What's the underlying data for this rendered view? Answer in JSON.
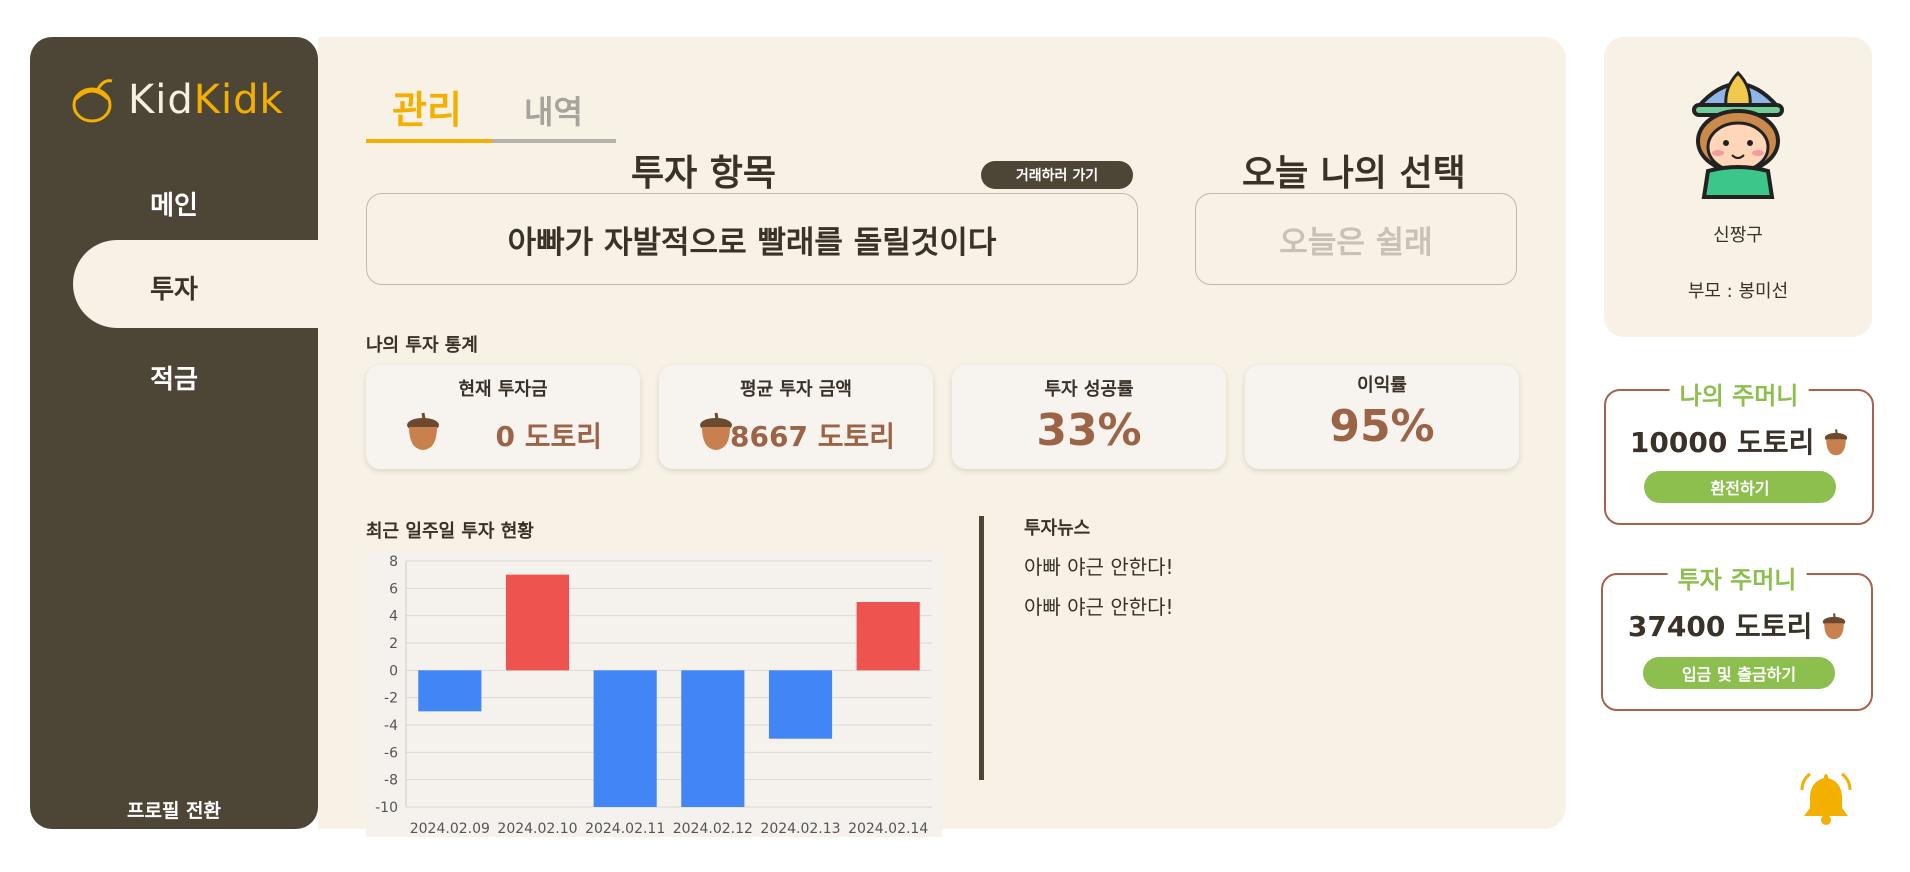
{
  "app": {
    "logo_part1": "Kid",
    "logo_part2": "Kidk"
  },
  "sidebar": {
    "items": [
      {
        "label": "메인"
      },
      {
        "label": "투자"
      },
      {
        "label": "적금"
      }
    ],
    "profile_switch": "프로필 전환"
  },
  "tabs": [
    {
      "label": "관리"
    },
    {
      "label": "내역"
    }
  ],
  "invest": {
    "title": "투자 항목",
    "go_trade": "거래하러 가기",
    "item": "아빠가 자발적으로 빨래를 돌릴것이다"
  },
  "choice": {
    "title": "오늘 나의 선택",
    "value": "오늘은 쉴래"
  },
  "stats": {
    "title": "나의 투자 통계",
    "cards": [
      {
        "title": "현재 투자금",
        "value": "0 도토리"
      },
      {
        "title": "평균 투자 금액",
        "value": "8667 도토리"
      },
      {
        "title": "투자 성공률",
        "value": "33%"
      },
      {
        "title": "이익률",
        "value": "95%"
      }
    ]
  },
  "weekly": {
    "title": "최근 일주일 투자 현황"
  },
  "news": {
    "title": "투자뉴스",
    "items": [
      "아빠 야근 안한다!",
      "아빠 야근 안한다!"
    ]
  },
  "profile": {
    "name": "신짱구",
    "parent": "부모 : 봉미선"
  },
  "wallet": {
    "title": "나의 주머니",
    "amount": "10000 도토리",
    "button": "환전하기"
  },
  "invest_wallet": {
    "title": "투자 주머니",
    "amount": "37400 도토리",
    "button": "입금 및 출금하기"
  },
  "colors": {
    "accent": "#f4b000",
    "sidebar": "#4d4535",
    "panel": "#f8f1e5",
    "gain": "#ef5350",
    "loss": "#4285f4",
    "green": "#8dbf4f",
    "value_brown": "#9c6447"
  },
  "chart_data": {
    "type": "bar",
    "categories": [
      "2024.02.09",
      "2024.02.10",
      "2024.02.11",
      "2024.02.12",
      "2024.02.13",
      "2024.02.14"
    ],
    "values": [
      -3,
      7,
      -10,
      -10,
      -5,
      5
    ],
    "ylim": [
      -10,
      8
    ],
    "yticks": [
      8,
      6,
      4,
      2,
      0,
      -2,
      -4,
      -6,
      -8,
      -10
    ],
    "grid": true,
    "xlabel": "",
    "ylabel": ""
  }
}
